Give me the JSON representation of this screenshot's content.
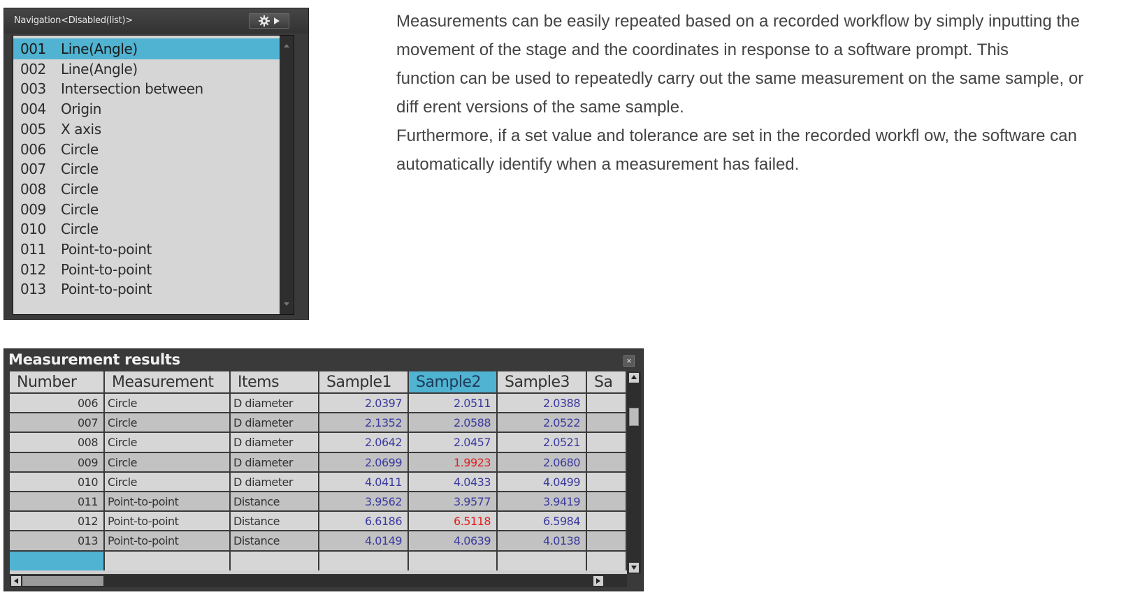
{
  "navigation": {
    "title": "Navigation<Disabled(list)>",
    "gear_icon": "gear-icon",
    "arrow_icon": "play-arrow-icon",
    "items": [
      {
        "num": "001",
        "label": "Line(Angle)",
        "selected": true
      },
      {
        "num": "002",
        "label": "Line(Angle)"
      },
      {
        "num": "003",
        "label": "Intersection between"
      },
      {
        "num": "004",
        "label": "Origin"
      },
      {
        "num": "005",
        "label": "X axis"
      },
      {
        "num": "006",
        "label": "Circle"
      },
      {
        "num": "007",
        "label": "Circle"
      },
      {
        "num": "008",
        "label": "Circle"
      },
      {
        "num": "009",
        "label": "Circle"
      },
      {
        "num": "010",
        "label": "Circle"
      },
      {
        "num": "011",
        "label": "Point-to-point"
      },
      {
        "num": "012",
        "label": "Point-to-point"
      },
      {
        "num": "013",
        "label": "Point-to-point"
      }
    ]
  },
  "description": {
    "lines": [
      "Measurements can be easily repeated based on a recorded workflow by simply inputting the",
      "movement of the stage and the coordinates in response to a software prompt. This",
      "function can be used to repeatedly carry out the same measurement on the same sample, or",
      "diff erent versions of the same sample.",
      "Furthermore, if a set value and tolerance are set in the recorded workfl ow, the software can",
      "automatically identify when a measurement has failed."
    ]
  },
  "results": {
    "title": "Measurement results",
    "close_icon": "close-icon",
    "columns": [
      "Number",
      "Measurement",
      "Items",
      "Sample1",
      "Sample2",
      "Sample3",
      "Sa"
    ],
    "active_column": 4,
    "rows": [
      {
        "number": "006",
        "measurement": "Circle",
        "item": "D diameter",
        "s1": "2.0397",
        "s2": "2.0511",
        "s3": "2.0388"
      },
      {
        "number": "007",
        "measurement": "Circle",
        "item": "D diameter",
        "s1": "2.1352",
        "s2": "2.0588",
        "s3": "2.0522"
      },
      {
        "number": "008",
        "measurement": "Circle",
        "item": "D diameter",
        "s1": "2.0642",
        "s2": "2.0457",
        "s3": "2.0521"
      },
      {
        "number": "009",
        "measurement": "Circle",
        "item": "D diameter",
        "s1": "2.0699",
        "s2": "1.9923",
        "s3": "2.0680",
        "s2_fail": true
      },
      {
        "number": "010",
        "measurement": "Circle",
        "item": "D diameter",
        "s1": "4.0411",
        "s2": "4.0433",
        "s3": "4.0499"
      },
      {
        "number": "011",
        "measurement": "Point-to-point",
        "item": "Distance",
        "s1": "3.9562",
        "s2": "3.9577",
        "s3": "3.9419"
      },
      {
        "number": "012",
        "measurement": "Point-to-point",
        "item": "Distance",
        "s1": "6.6186",
        "s2": "6.5118",
        "s3": "6.5984",
        "s2_fail": true
      },
      {
        "number": "013",
        "measurement": "Point-to-point",
        "item": "Distance",
        "s1": "4.0149",
        "s2": "4.0639",
        "s3": "4.0138"
      }
    ],
    "colors": {
      "selection": "#4fb3d1",
      "value": "#3a3aa0",
      "fail": "#e02020"
    }
  }
}
